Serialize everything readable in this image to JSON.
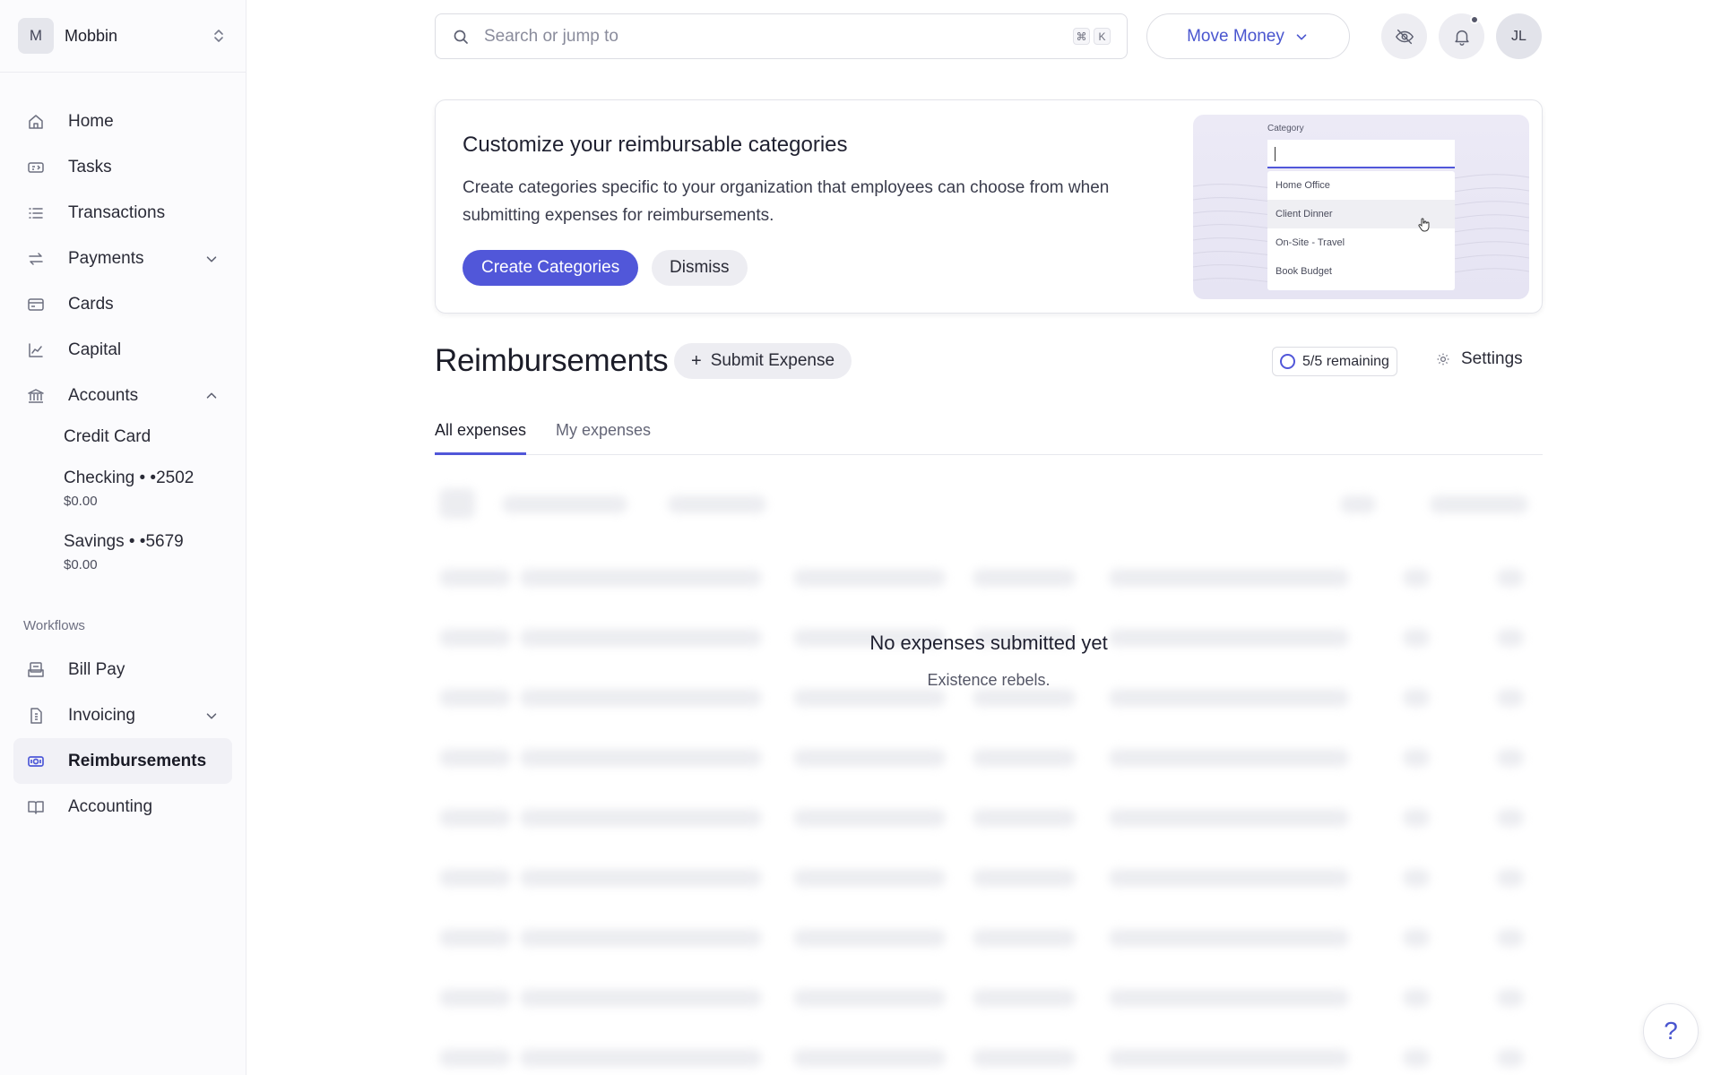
{
  "org": {
    "initial": "M",
    "name": "Mobbin"
  },
  "nav": {
    "home": "Home",
    "tasks": "Tasks",
    "transactions": "Transactions",
    "payments": "Payments",
    "cards": "Cards",
    "capital": "Capital",
    "accounts": "Accounts",
    "accounts_sub": {
      "credit_card": "Credit Card",
      "checking": "Checking • •2502",
      "checking_amount": "$0.00",
      "savings": "Savings • •5679",
      "savings_amount": "$0.00"
    },
    "workflows_label": "Workflows",
    "bill_pay": "Bill Pay",
    "invoicing": "Invoicing",
    "reimbursements": "Reimbursements",
    "accounting": "Accounting"
  },
  "topbar": {
    "search_placeholder": "Search or jump to",
    "shortcut_mod": "⌘",
    "shortcut_key": "K",
    "move_money": "Move Money",
    "user_initials": "JL"
  },
  "promo": {
    "title": "Customize your reimbursable categories",
    "description": "Create categories specific to your organization that employees can choose from when submitting expenses for reimbursements.",
    "primary_button": "Create Categories",
    "secondary_button": "Dismiss",
    "art": {
      "label": "Category",
      "options": [
        "Home Office",
        "Client Dinner",
        "On-Site - Travel",
        "Book Budget"
      ]
    }
  },
  "page": {
    "title": "Reimbursements",
    "submit_button": "Submit Expense",
    "remaining": "5/5 remaining",
    "settings": "Settings",
    "tabs": [
      "All expenses",
      "My expenses"
    ],
    "empty_title": "No expenses submitted yet",
    "empty_subtitle": "Existence rebels."
  },
  "help": {
    "label": "?"
  },
  "colors": {
    "accent": "#5157d9",
    "text": "#1e1f2b",
    "muted": "#6e7082"
  }
}
